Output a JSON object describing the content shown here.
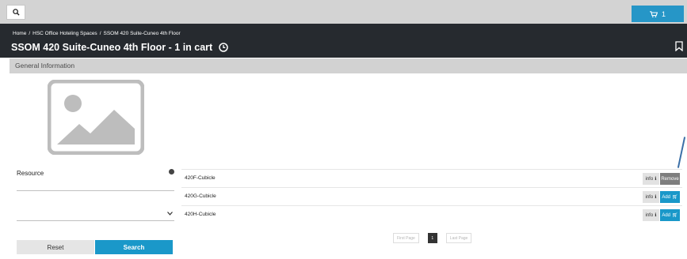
{
  "topbar": {
    "search_icon": "search-icon",
    "cart_icon": "cart-icon",
    "cart_count": "1",
    "accent_color": "#2696c7"
  },
  "header": {
    "breadcrumb": [
      {
        "label": "Home"
      },
      {
        "label": "HSC Office Hoteling Spaces"
      },
      {
        "label": "SSOM 420 Suite-Cuneo 4th Floor"
      }
    ],
    "breadcrumb_separator": "/",
    "title": "SSOM 420 Suite-Cuneo 4th Floor  - 1 in cart",
    "clock_icon": "clock-icon",
    "bookmark_icon": "bookmark-icon"
  },
  "section": {
    "label": "General Information"
  },
  "filters": {
    "resource_label": "Resource",
    "resource_value": "",
    "select_value": "",
    "reset_label": "Reset",
    "search_label": "Search"
  },
  "resources": [
    {
      "name": "420F-Cubicle",
      "info_label": "info",
      "action_label": "Remove",
      "action": "remove"
    },
    {
      "name": "420G-Cubicle",
      "info_label": "info",
      "action_label": "Add",
      "action": "add"
    },
    {
      "name": "420H-Cubicle",
      "info_label": "info",
      "action_label": "Add",
      "action": "add"
    }
  ],
  "pagination": {
    "first_label": "First Page",
    "current_page": "1",
    "last_label": "Last Page"
  },
  "colors": {
    "header_bg": "#262a2f",
    "primary": "#1a98c9",
    "remove": "#7e7e7e"
  }
}
